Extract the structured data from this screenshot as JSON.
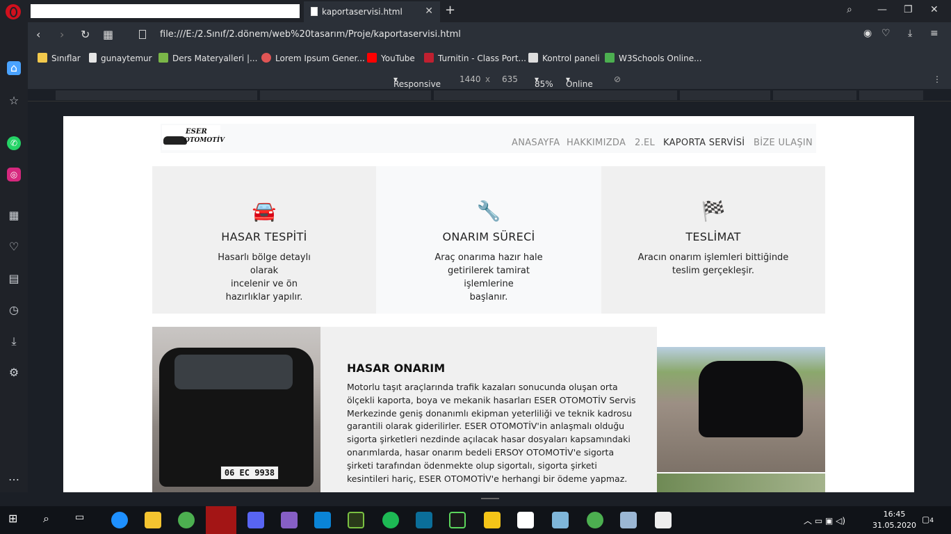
{
  "browser": {
    "tab_title": "kaportaservisi.html",
    "url": "file:///E:/2.Sınıf/2.dönem/web%20tasarım/Proje/kaportaservisi.html",
    "bookmarks": [
      {
        "label": "Sınıflar",
        "color": "#f2c94c"
      },
      {
        "label": "gunaytemur",
        "color": "#e6e6e6"
      },
      {
        "label": "Ders Materyalleri |...",
        "color": "#7ab648"
      },
      {
        "label": "Lorem Ipsum Gener...",
        "color": "#e05555"
      },
      {
        "label": "YouTube",
        "color": "#ff0000"
      },
      {
        "label": "Turnitin - Class Port...",
        "color": "#c02030"
      },
      {
        "label": "Kontrol paneli",
        "color": "#dddddd"
      },
      {
        "label": "W3Schools Online...",
        "color": "#4caf50"
      }
    ]
  },
  "devtools": {
    "device": "Responsive",
    "width": "1440",
    "x": "x",
    "height": "635",
    "zoom": "85%",
    "network": "Online"
  },
  "site": {
    "logo_line1": "ESER",
    "logo_line2": "OTOMOTİV",
    "nav": [
      "ANASAYFA",
      "HAKKIMIZDA",
      "2.EL",
      "KAPORTA SERVİSİ",
      "BİZE ULAŞIN"
    ],
    "features": [
      {
        "title": "HASAR TESPİTİ",
        "text_l1": "Hasarlı bölge detaylı olarak",
        "text_l2": "incelenir ve ön hazırlıklar yapılır.",
        "text_l3": "",
        "icon": "car-crash-icon"
      },
      {
        "title": "ONARIM SÜRECİ",
        "text_l1": "Araç onarıma hazır hale",
        "text_l2": "getirilerek tamirat işlemlerine",
        "text_l3": "başlanır.",
        "icon": "wrench-icon"
      },
      {
        "title": "TESLİMAT",
        "text_l1": "Aracın onarım işlemleri bittiğinde",
        "text_l2": "teslim gerçekleşir.",
        "text_l3": "",
        "icon": "checkered-flag-icon"
      }
    ],
    "section_title": "HASAR ONARIM",
    "section_text": "Motorlu taşıt araçlarında trafik kazaları sonucunda oluşan orta ölçekli kaporta, boya ve mekanik hasarları ESER OTOMOTİV Servis Merkezinde geniş donanımlı ekipman yeterliliği ve teknik kadrosu garantili olarak giderilirler. ESER OTOMOTİV'in anlaşmalı olduğu sigorta şirketleri nezdinde açılacak hasar dosyaları kapsamındaki onarımlarda, hasar onarım bedeli ERSOY OTOMOTİV'e sigorta şirketi tarafından ödenmekte olup sigortalı, sigorta şirketi kesintileri hariç, ESER OTOMOTİV'e herhangi bir ödeme yapmaz.",
    "plate": "06 EC 9938"
  },
  "taskbar": {
    "time": "16:45",
    "date": "31.05.2020",
    "notifications": "4"
  }
}
